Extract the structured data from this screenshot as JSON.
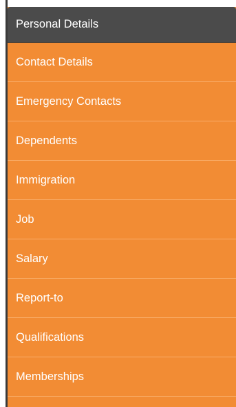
{
  "menu": {
    "items": [
      {
        "label": "Personal Details",
        "active": true
      },
      {
        "label": "Contact Details",
        "active": false
      },
      {
        "label": "Emergency Contacts",
        "active": false
      },
      {
        "label": "Dependents",
        "active": false
      },
      {
        "label": "Immigration",
        "active": false
      },
      {
        "label": "Job",
        "active": false
      },
      {
        "label": "Salary",
        "active": false
      },
      {
        "label": "Report-to",
        "active": false
      },
      {
        "label": "Qualifications",
        "active": false
      },
      {
        "label": "Memberships",
        "active": false
      }
    ]
  },
  "colors": {
    "menu_background": "#f28c34",
    "active_background": "#4b4b4b",
    "text": "#ffffff"
  }
}
